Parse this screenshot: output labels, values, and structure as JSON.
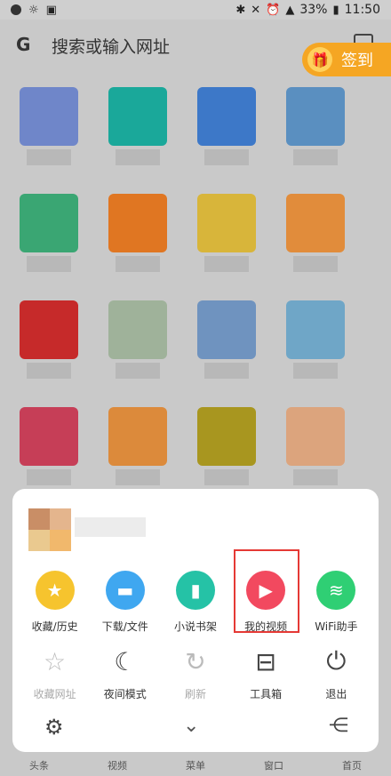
{
  "status": {
    "battery": "33%",
    "time": "11:50"
  },
  "search": {
    "placeholder": "搜索或输入网址"
  },
  "signin": {
    "label": "签到"
  },
  "tiles": [
    {
      "color": "#6f86c9"
    },
    {
      "color": "#1aa89a"
    },
    {
      "color": "#3d78c8"
    },
    {
      "color": "#5a8fc0"
    },
    {
      "color": "#3aa673"
    },
    {
      "color": "#e07622"
    },
    {
      "color": "#d8b53a"
    },
    {
      "color": "#e18c3b"
    },
    {
      "color": "#c62a2a"
    },
    {
      "color": "#9fb29a"
    },
    {
      "color": "#6f93bf"
    },
    {
      "color": "#6fa6c7"
    },
    {
      "color": "#c63e57"
    },
    {
      "color": "#dc8a3b"
    },
    {
      "color": "#a8961f"
    },
    {
      "color": "#dca47d"
    }
  ],
  "menu": {
    "row1": [
      {
        "label": "收藏/历史",
        "icon": "star-icon",
        "color": "#f6c42e"
      },
      {
        "label": "下载/文件",
        "icon": "folder-icon",
        "color": "#3fa7f0"
      },
      {
        "label": "小说书架",
        "icon": "book-icon",
        "color": "#25c2a6"
      },
      {
        "label": "我的视频",
        "icon": "play-icon",
        "color": "#f2495f"
      },
      {
        "label": "WiFi助手",
        "icon": "wifi-icon",
        "color": "#2fcf74"
      }
    ],
    "row2": [
      {
        "label": "收藏网址",
        "icon": "star-add-icon"
      },
      {
        "label": "夜间模式",
        "icon": "moon-icon"
      },
      {
        "label": "刷新",
        "icon": "refresh-icon"
      },
      {
        "label": "工具箱",
        "icon": "toolbox-icon"
      },
      {
        "label": "退出",
        "icon": "power-icon"
      }
    ]
  },
  "bottomnav": [
    "头条",
    "视频",
    "菜单",
    "窗口",
    "首页"
  ]
}
